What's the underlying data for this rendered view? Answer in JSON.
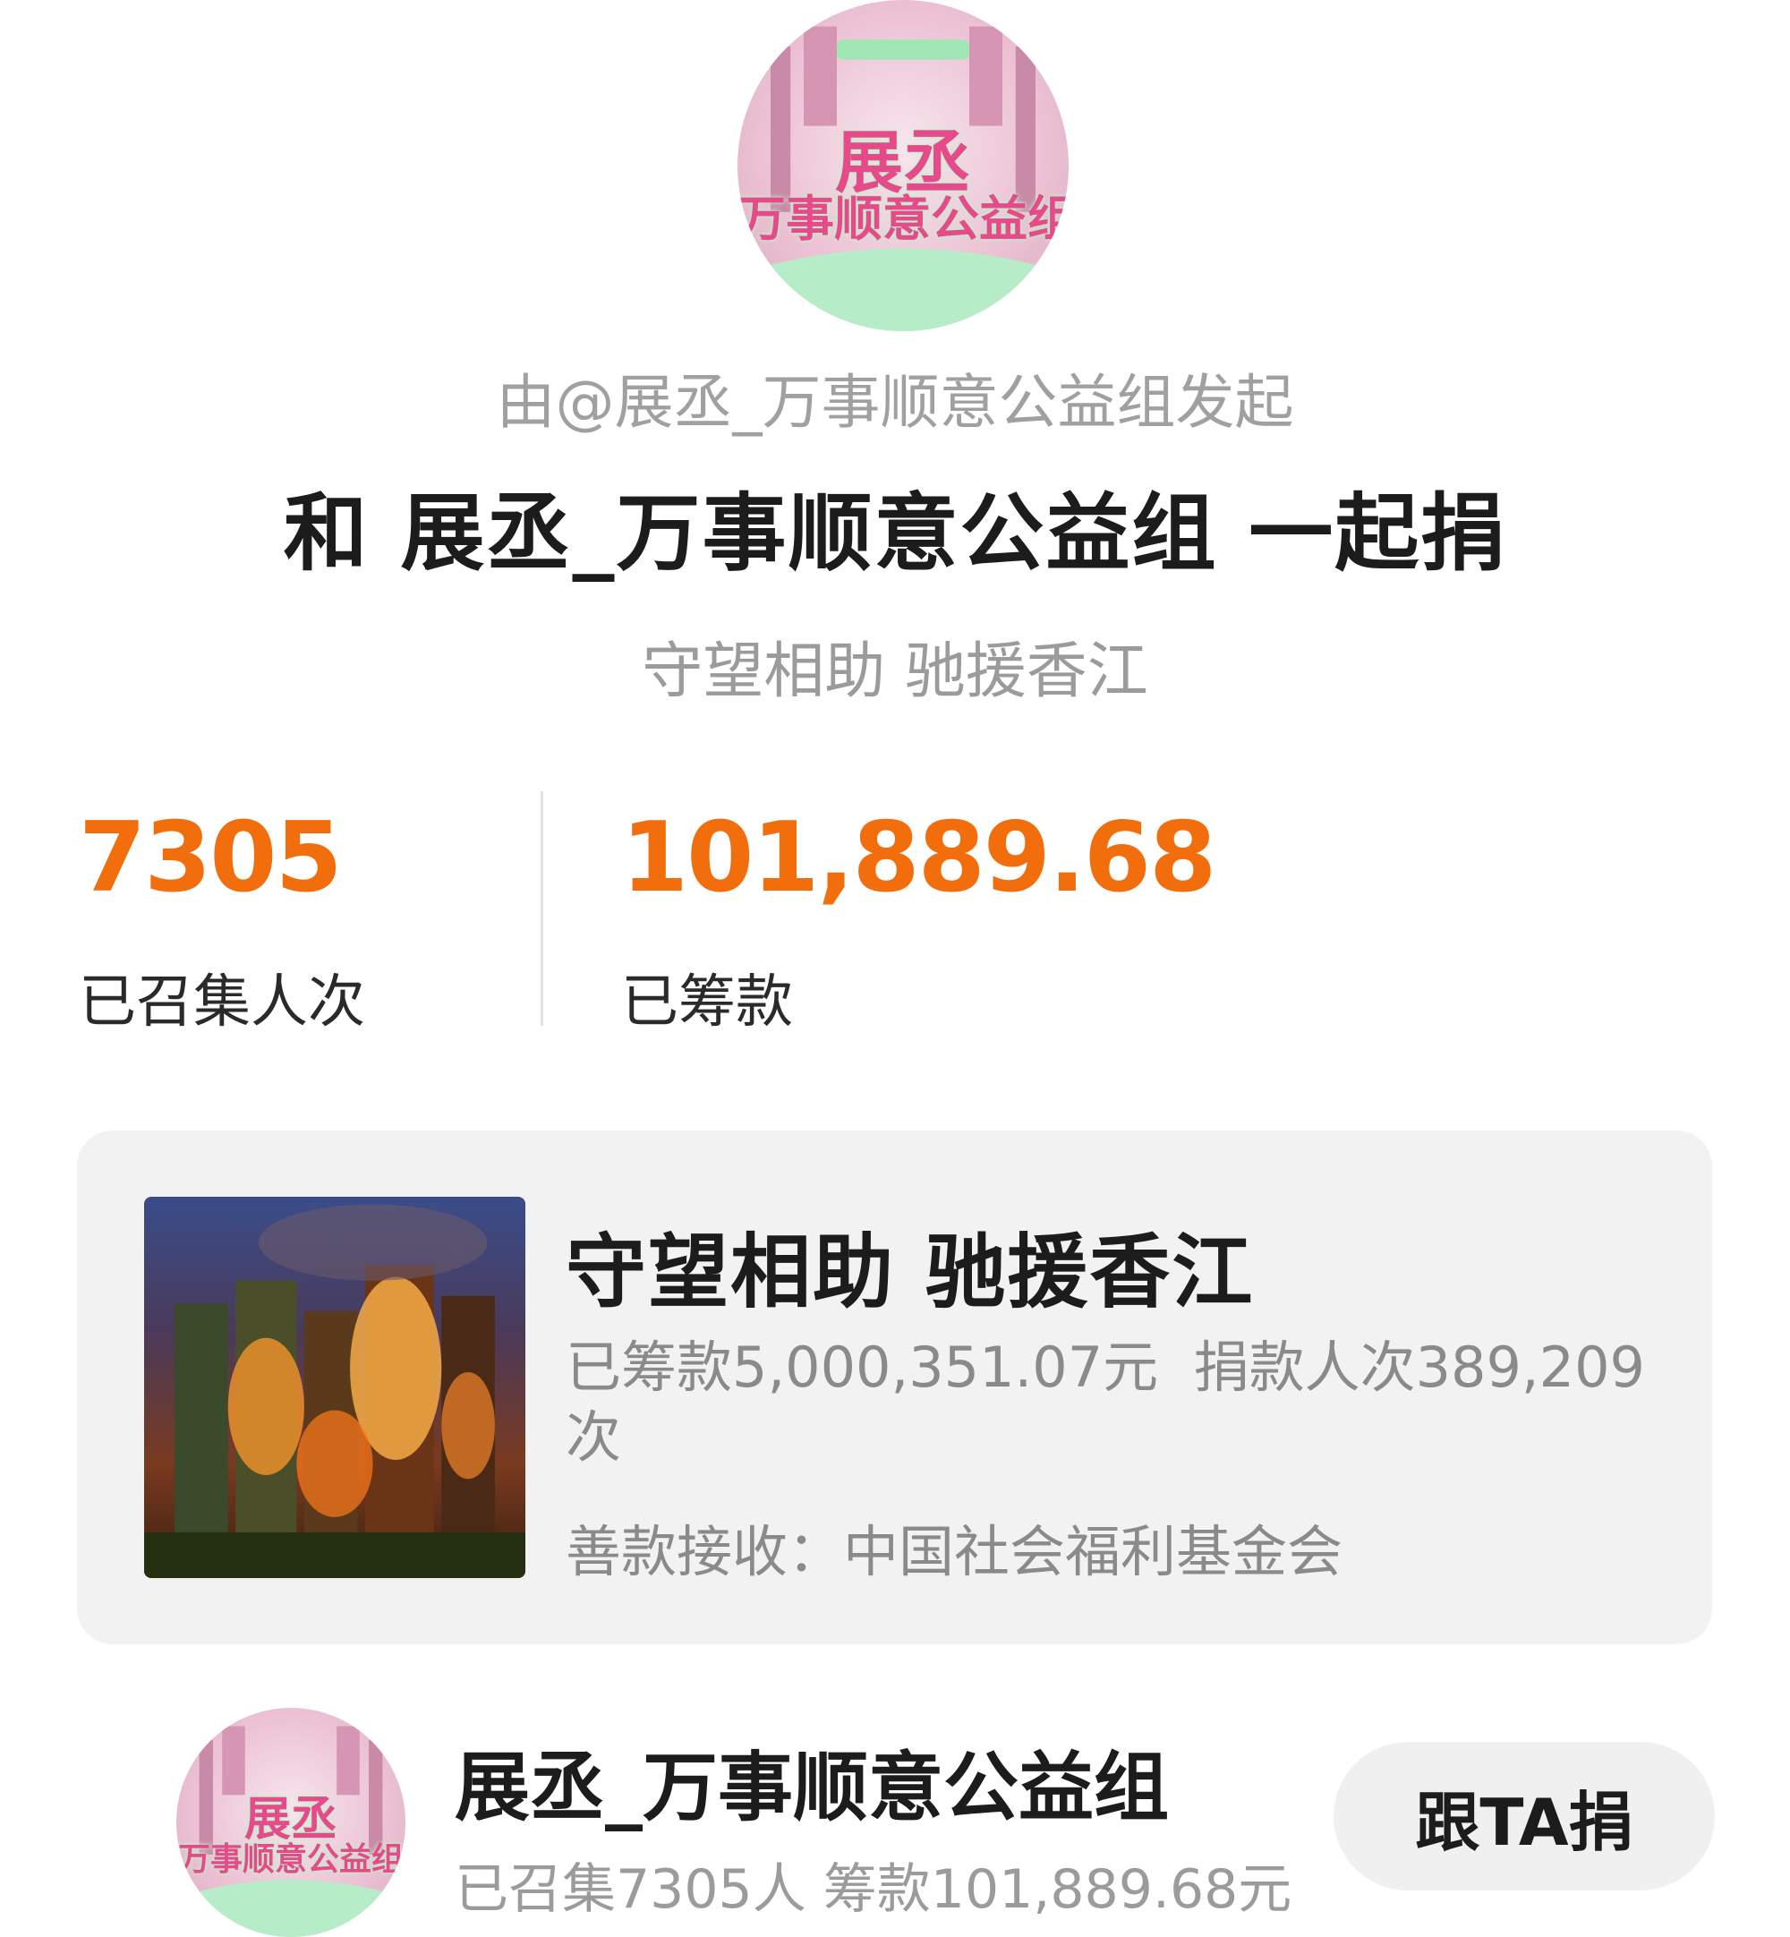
{
  "header": {
    "initiator": "由@展丞_万事顺意公益组发起",
    "headline": "和 展丞_万事顺意公益组 一起捐",
    "subtitle": "守望相助 驰援香江"
  },
  "avatar_art": {
    "line1": "展丞",
    "line2": "万事顺意公益组"
  },
  "stats": {
    "people_value": "7305",
    "people_label": "已召集人次",
    "amount_value": "101,889.68",
    "amount_label": "已筹款"
  },
  "project": {
    "title": "守望相助 驰援香江",
    "raised": "已筹款5,000,351.07元",
    "donors": "捐款人次389,209次",
    "receiver": "善款接收：中国社会福利基金会"
  },
  "organizer": {
    "name": "展丞_万事顺意公益组",
    "summary": "已召集7305人 筹款101,889.68元",
    "follow_label": "跟TA捐"
  },
  "colors": {
    "accent_orange": "#f26d0c",
    "card_bg": "#f2f2f2",
    "muted_text": "#9b9b9b"
  }
}
